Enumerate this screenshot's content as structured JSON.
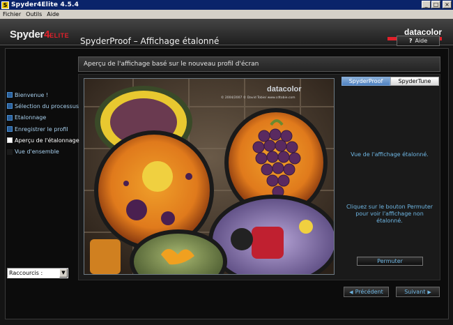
{
  "window": {
    "title": "Spyder4Elite 4.5.4",
    "icon_letter": "S",
    "minimize": "_",
    "maximize": "□",
    "close": "×"
  },
  "menu": [
    "Fichier",
    "Outils",
    "Aide"
  ],
  "header": {
    "logo_main": "Spyder",
    "logo_num": "4",
    "logo_edition": "ELITE",
    "brand": "datacolor",
    "brand_color": "#e0202a"
  },
  "page": {
    "title": "SpyderProof – Affichage étalonné",
    "help_label": "Aide",
    "help_symbol": "?",
    "subtitle": "Aperçu de l'affichage basé sur le nouveau profil d'écran"
  },
  "image": {
    "watermark": "datacolor",
    "credit": "© 2004/2007 © David Tobie/ www.cdtobie.com"
  },
  "tabs": {
    "active": "SpyderProof",
    "inactive": "SpyderTune"
  },
  "right_panel": {
    "info1": "Vue de l'affichage étalonné.",
    "info2": "Cliquez sur le bouton Permuter pour voir l'affichage non étalonné.",
    "switch_label": "Permuter"
  },
  "nav": {
    "items": [
      {
        "label": "Bienvenue !",
        "state": "done"
      },
      {
        "label": "Sélection du processus",
        "state": "done"
      },
      {
        "label": "Etalonnage",
        "state": "done"
      },
      {
        "label": "Enregistrer le profil",
        "state": "done"
      },
      {
        "label": "Aperçu de l'étalonnage",
        "state": "current"
      },
      {
        "label": "Vue d'ensemble",
        "state": "pending"
      }
    ],
    "shortcut_value": "Raccourcis :"
  },
  "footer": {
    "prev_label": "Précédent",
    "next_label": "Suivant"
  },
  "colors": {
    "accent_blue": "#6fb7e4",
    "tab_active": "#4f82c2",
    "background": "#141414"
  }
}
